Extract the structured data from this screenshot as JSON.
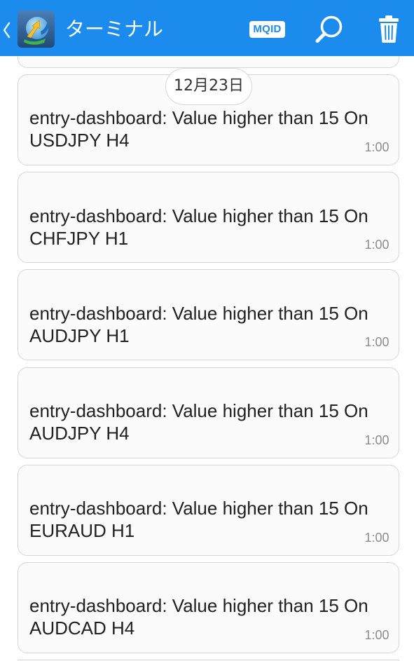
{
  "header": {
    "title": "ターミナル",
    "mqid_label": "MQID",
    "icons": {
      "back": "chevron-left-icon",
      "logo": "metatrader-logo-icon",
      "search": "search-icon",
      "delete": "trash-icon"
    }
  },
  "date_separator": "12月23日",
  "messages": [
    {
      "text": "entry-dashboard: Value higher than 15 On USDJPY H4",
      "time": "1:00"
    },
    {
      "text": "entry-dashboard: Value higher than 15 On CHFJPY H1",
      "time": "1:00"
    },
    {
      "text": "entry-dashboard: Value higher than 15 On AUDJPY H1",
      "time": "1:00"
    },
    {
      "text": "entry-dashboard: Value higher than 15 On AUDJPY H4",
      "time": "1:00"
    },
    {
      "text": "entry-dashboard: Value higher than 15 On EURAUD H1",
      "time": "1:00"
    },
    {
      "text": "entry-dashboard: Value higher than 15 On AUDCAD H4",
      "time": "1:00"
    }
  ],
  "colors": {
    "header_background": "#1b8ced",
    "message_text": "#212121",
    "time_text": "#8c8c8c",
    "card_border": "#d6d6d6",
    "card_background": "#fbfbfb"
  }
}
